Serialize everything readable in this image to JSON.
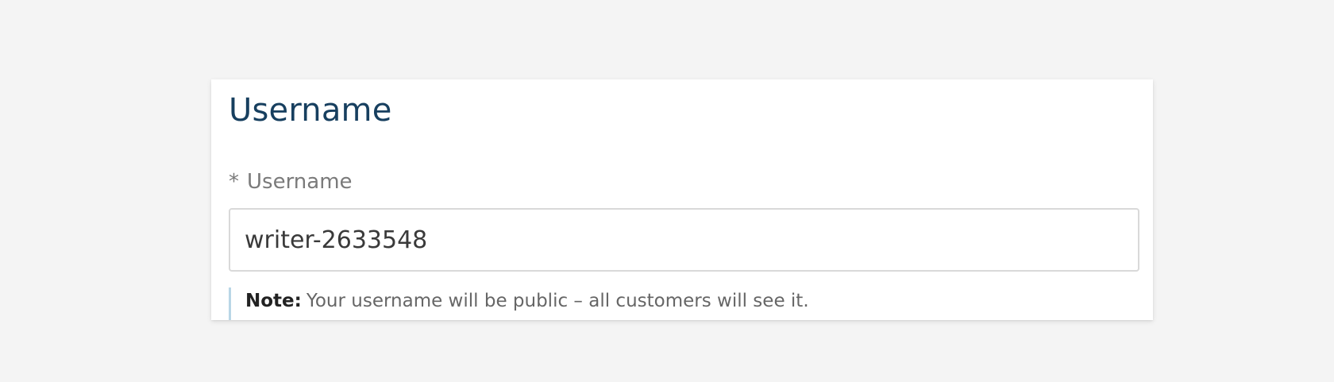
{
  "section": {
    "title": "Username"
  },
  "field": {
    "required_marker": "*",
    "label": "Username",
    "value": "writer-2633548"
  },
  "note": {
    "label": "Note:",
    "text": "Your username will be public – all customers will see it."
  },
  "colors": {
    "title": "#173f5f",
    "label": "#7a7a7a",
    "note_border": "#b9d6e6",
    "input_border": "#d9d9d9",
    "background": "#f4f4f4"
  }
}
